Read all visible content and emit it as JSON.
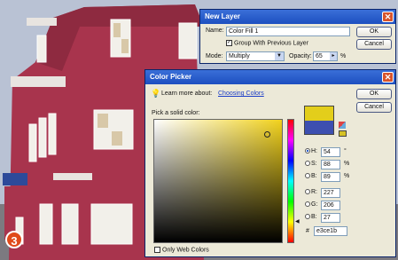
{
  "new_layer": {
    "title": "New Layer",
    "name_label": "Name:",
    "name_value": "Color Fill 1",
    "group_label": "Group With Previous Layer",
    "mode_label": "Mode:",
    "mode_value": "Multiply",
    "opacity_label": "Opacity:",
    "opacity_value": "65",
    "opacity_unit": "%",
    "ok": "OK",
    "cancel": "Cancel"
  },
  "color_picker": {
    "title": "Color Picker",
    "learn_label": "Learn more about:",
    "learn_link": "Choosing Colors",
    "pick_label": "Pick a solid color:",
    "ok": "OK",
    "cancel": "Cancel",
    "h_label": "H:",
    "h_value": "54",
    "h_unit": "°",
    "s_label": "S:",
    "s_value": "88",
    "s_unit": "%",
    "b_label": "B:",
    "b_value": "89",
    "b_unit": "%",
    "r_label": "R:",
    "r_value": "227",
    "g_label": "G:",
    "g_value": "206",
    "bl_label": "B:",
    "bl_value": "27",
    "hex_label": "#",
    "hex_value": "e3ce1b",
    "web_only_label": "Only Web Colors",
    "new_color": "#e3ce1b",
    "old_color": "#3d4fb0"
  },
  "step_number": "3"
}
